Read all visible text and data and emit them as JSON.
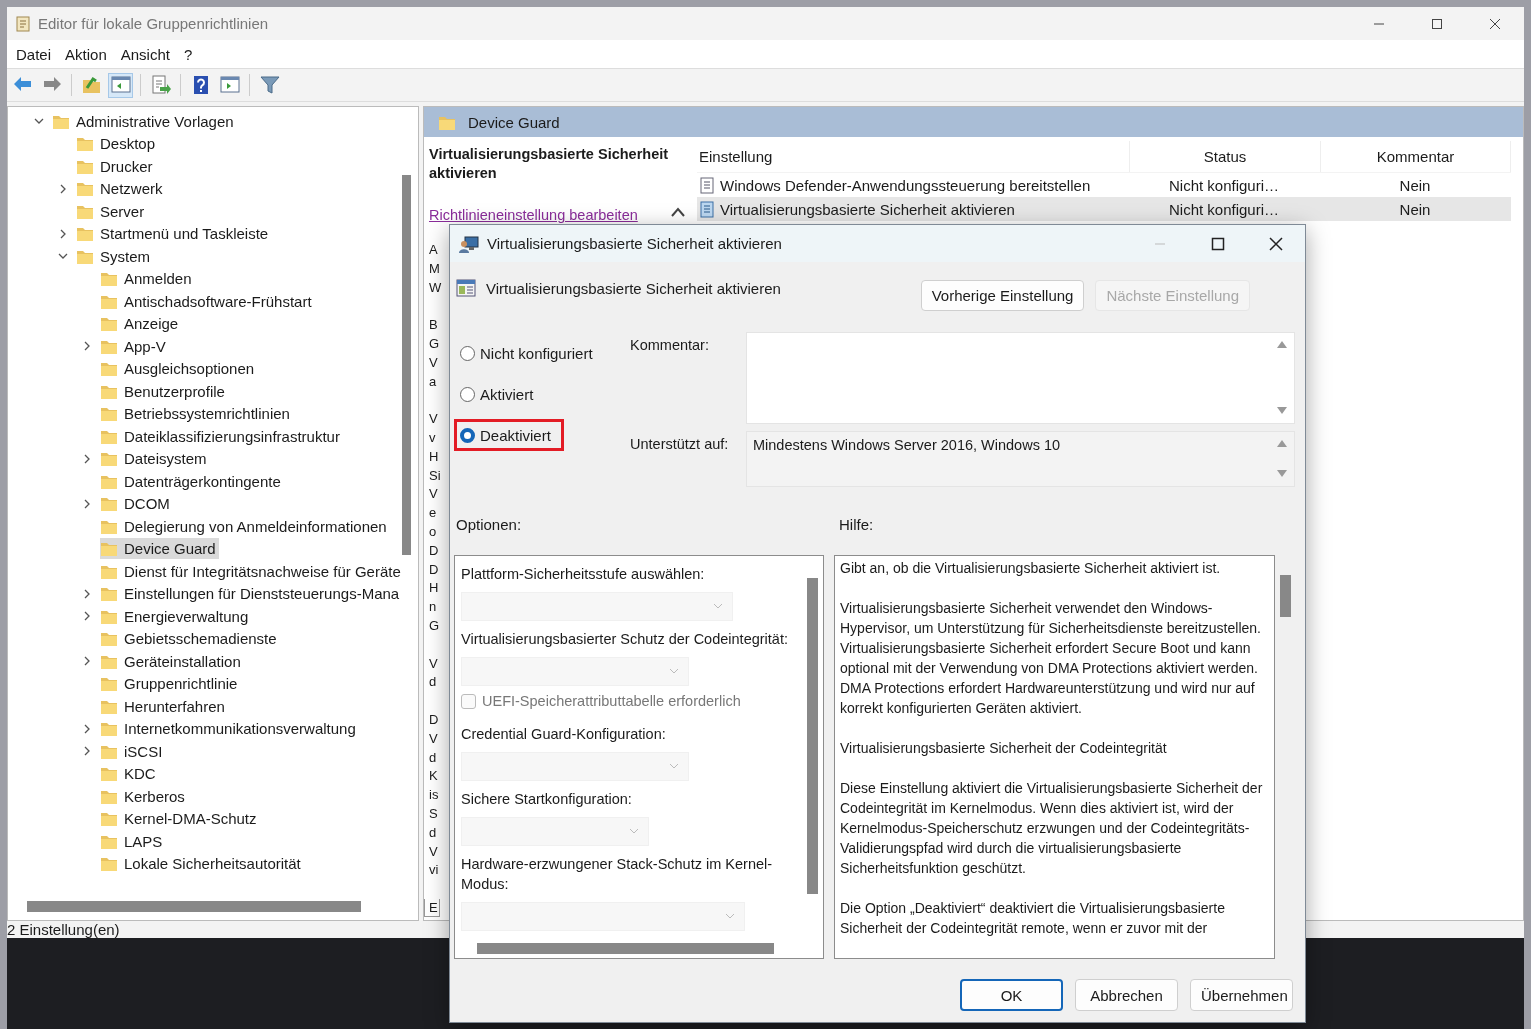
{
  "window": {
    "title": "Editor für lokale Gruppenrichtlinien"
  },
  "menu": [
    "Datei",
    "Aktion",
    "Ansicht",
    "?"
  ],
  "toolbar": [
    [
      {
        "kind": "back",
        "pressed": false
      },
      {
        "kind": "forward",
        "pressed": false
      }
    ],
    [
      {
        "kind": "folder-up",
        "pressed": false
      },
      {
        "kind": "console-tree",
        "pressed": true
      }
    ],
    [
      {
        "kind": "export",
        "pressed": false
      }
    ],
    [
      {
        "kind": "help",
        "pressed": false
      },
      {
        "kind": "action-pane",
        "pressed": false
      }
    ],
    [
      {
        "kind": "filter",
        "pressed": false
      }
    ]
  ],
  "tree": [
    {
      "label": "Administrative Vorlagen",
      "expanded": true,
      "selected": false,
      "children": [
        {
          "label": "Desktop",
          "selected": false
        },
        {
          "label": "Drucker",
          "selected": false
        },
        {
          "label": "Netzwerk",
          "expanded": false,
          "selected": false
        },
        {
          "label": "Server",
          "selected": false
        },
        {
          "label": "Startmenü und Taskleiste",
          "expanded": false,
          "selected": false
        },
        {
          "label": "System",
          "expanded": true,
          "selected": false,
          "children": [
            {
              "label": "Anmelden",
              "selected": false
            },
            {
              "label": "Antischadsoftware-Frühstart",
              "selected": false
            },
            {
              "label": "Anzeige",
              "selected": false
            },
            {
              "label": "App-V",
              "expanded": false,
              "selected": false
            },
            {
              "label": "Ausgleichsoptionen",
              "selected": false
            },
            {
              "label": "Benutzerprofile",
              "selected": false
            },
            {
              "label": "Betriebssystemrichtlinien",
              "selected": false
            },
            {
              "label": "Dateiklassifizierungsinfrastruktur",
              "selected": false
            },
            {
              "label": "Dateisystem",
              "expanded": false,
              "selected": false
            },
            {
              "label": "Datenträgerkontingente",
              "selected": false
            },
            {
              "label": "DCOM",
              "expanded": false,
              "selected": false
            },
            {
              "label": "Delegierung von Anmeldeinformationen",
              "selected": false
            },
            {
              "label": "Device Guard",
              "selected": true
            },
            {
              "label": "Dienst für Integritätsnachweise für Geräte",
              "selected": false
            },
            {
              "label": "Einstellungen für Dienststeuerungs-Mana",
              "expanded": false,
              "selected": false
            },
            {
              "label": "Energieverwaltung",
              "expanded": false,
              "selected": false
            },
            {
              "label": "Gebietsschemadienste",
              "selected": false
            },
            {
              "label": "Geräteinstallation",
              "expanded": false,
              "selected": false
            },
            {
              "label": "Gruppenrichtlinie",
              "selected": false
            },
            {
              "label": "Herunterfahren",
              "selected": false
            },
            {
              "label": "Internetkommunikationsverwaltung",
              "expanded": false,
              "selected": false
            },
            {
              "label": "iSCSI",
              "expanded": false,
              "selected": false
            },
            {
              "label": "KDC",
              "selected": false
            },
            {
              "label": "Kerberos",
              "selected": false
            },
            {
              "label": "Kernel-DMA-Schutz",
              "selected": false
            },
            {
              "label": "LAPS",
              "selected": false
            },
            {
              "label": "Lokale Sicherheitsautorität",
              "selected": false
            }
          ]
        }
      ]
    }
  ],
  "details": {
    "header": "Device Guard",
    "policy_title": "Virtualisierungsbasierte Sicherheit aktivieren",
    "edit_link": "Richtlinieneinstellung bearbeiten",
    "fragments": [
      [
        "A",
        "M",
        "W"
      ],
      [
        "B",
        "G",
        "V",
        "a"
      ],
      [
        "V",
        "v",
        "H",
        "Si",
        "V",
        "e",
        "o",
        "D",
        "D",
        "H",
        "n",
        "G"
      ],
      [
        "V",
        "d"
      ],
      [
        "D",
        "V",
        "d",
        "K",
        "is",
        "S",
        "d",
        "V",
        "vi"
      ]
    ],
    "tabs": [
      {
        "label": "E",
        "selected": true
      }
    ]
  },
  "settings_list": {
    "columns": [
      "Einstellung",
      "Status",
      "Kommentar"
    ],
    "rows": [
      {
        "name": "Windows Defender-Anwendungssteuerung bereitstellen",
        "status": "Nicht konfiguri…",
        "comment": "Nein",
        "selected": false
      },
      {
        "name": "Virtualisierungsbasierte Sicherheit aktivieren",
        "status": "Nicht konfiguri…",
        "comment": "Nein",
        "selected": true
      }
    ]
  },
  "status_bar": "2 Einstellung(en)",
  "dialog": {
    "title": "Virtualisierungsbasierte Sicherheit aktivieren",
    "policy_name": "Virtualisierungsbasierte Sicherheit aktivieren",
    "nav_buttons": [
      {
        "label": "Vorherige Einstellung",
        "disabled": false
      },
      {
        "label": "Nächste Einstellung",
        "disabled": true
      }
    ],
    "states": [
      {
        "label": "Nicht konfiguriert",
        "selected": false,
        "highlighted": false
      },
      {
        "label": "Aktiviert",
        "selected": false,
        "highlighted": false
      },
      {
        "label": "Deaktiviert",
        "selected": true,
        "highlighted": true
      }
    ],
    "comment_label": "Kommentar:",
    "supported_label": "Unterstützt auf:",
    "supported_on": "Mindestens Windows Server 2016, Windows 10",
    "options_label": "Optionen:",
    "help_label": "Hilfe:",
    "options": [
      {
        "kind": "dropdown",
        "label": "Plattform-Sicherheitsstufe auswählen:",
        "disabled": true
      },
      {
        "kind": "dropdown",
        "label": "Virtualisierungsbasierter Schutz der Codeintegrität:",
        "disabled": true
      },
      {
        "kind": "checkbox",
        "label": "UEFI-Speicherattributtabelle erforderlich",
        "checked": false,
        "disabled": true
      },
      {
        "kind": "dropdown",
        "label": "Credential Guard-Konfiguration:",
        "disabled": true
      },
      {
        "kind": "dropdown",
        "label": "Sichere Startkonfiguration:",
        "disabled": true
      },
      {
        "kind": "dropdown",
        "label": "Hardware-erzwungener Stack-Schutz im Kernel-Modus:",
        "disabled": true
      }
    ],
    "help": [
      "Gibt an, ob die Virtualisierungsbasierte Sicherheit aktiviert ist.",
      "Virtualisierungsbasierte Sicherheit verwendet den Windows-Hypervisor, um Unterstützung für Sicherheitsdienste bereitzustellen. Virtualisierungsbasierte Sicherheit erfordert Secure Boot und kann optional mit der Verwendung von DMA Protections aktiviert werden. DMA Protections erfordert Hardwareunterstützung und wird nur auf korrekt konfigurierten Geräten aktiviert.",
      "Virtualisierungsbasierte Sicherheit der Codeintegrität",
      "Diese Einstellung aktiviert die Virtualisierungsbasierte Sicherheit der Codeintegrität im Kernelmodus. Wenn dies aktiviert ist, wird der Kernelmodus-Speicherschutz erzwungen und der Codeintegritäts-Validierungspfad wird durch die virtualisierungsbasierte Sicherheitsfunktion geschützt.",
      "Die Option „Deaktiviert“ deaktiviert die Virtualisierungsbasierte Sicherheit der Codeintegrität remote, wenn er zuvor mit der"
    ],
    "buttons": [
      {
        "label": "OK",
        "default": true
      },
      {
        "label": "Abbrechen",
        "default": false
      },
      {
        "label": "Übernehmen",
        "default": false
      }
    ]
  }
}
